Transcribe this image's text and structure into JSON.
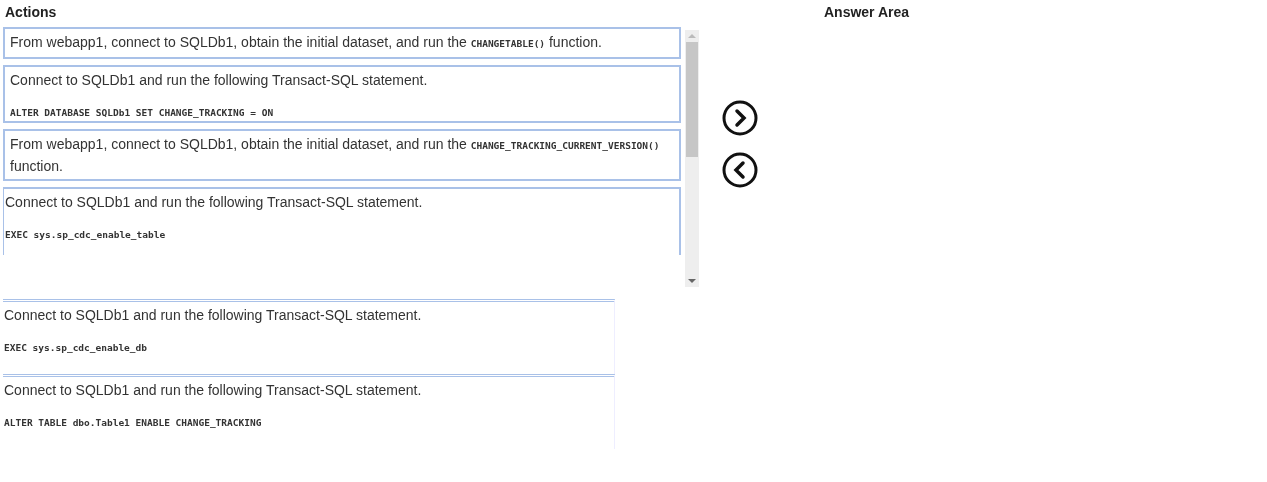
{
  "actions": {
    "title": "Actions",
    "items": [
      {
        "kind": "inline",
        "before": "From webapp1, connect to SQLDb1, obtain the initial dataset, and run the ",
        "code": "CHANGETABLE()",
        "after": " function."
      },
      {
        "kind": "statement",
        "text": "Connect to SQLDb1 and run the following Transact-SQL statement.",
        "code": "ALTER DATABASE SQLDb1 SET CHANGE_TRACKING = ON"
      },
      {
        "kind": "inline",
        "before": "From webapp1, connect to SQLDb1, obtain the initial dataset, and run the ",
        "code": "CHANGE_TRACKING_CURRENT_VERSION()",
        "after": " function."
      },
      {
        "kind": "statement",
        "text": "Connect to SQLDb1 and run the following Transact-SQL statement.",
        "code": "EXEC sys.sp_cdc_enable_table"
      }
    ],
    "overflow_items": [
      {
        "kind": "statement",
        "text": "Connect to SQLDb1 and run the following Transact-SQL statement.",
        "code": "EXEC sys.sp_cdc_enable_db"
      },
      {
        "kind": "statement",
        "text": "Connect to SQLDb1 and run the following Transact-SQL statement.",
        "code": "ALTER TABLE dbo.Table1 ENABLE CHANGE_TRACKING"
      }
    ]
  },
  "answer_area": {
    "title": "Answer Area"
  }
}
